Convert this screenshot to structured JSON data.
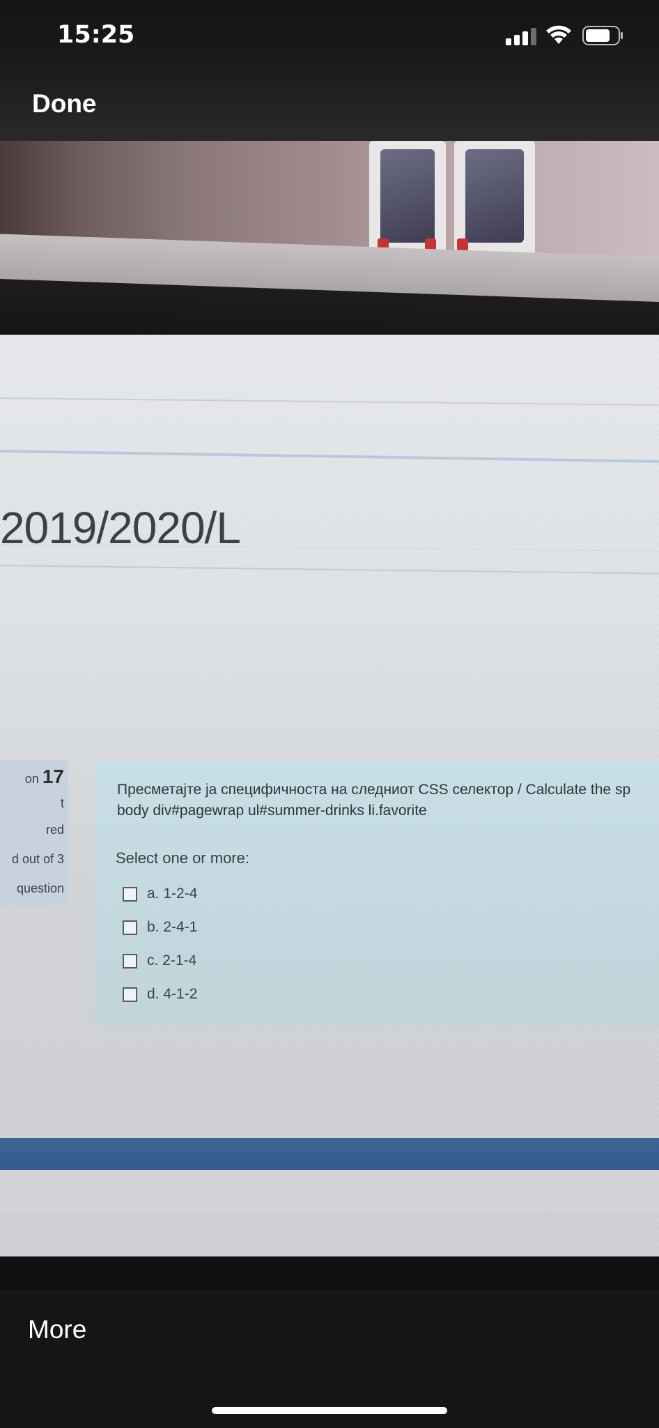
{
  "status_bar": {
    "time": "15:25"
  },
  "nav": {
    "done_label": "Done"
  },
  "photo": {
    "course_title": "2019/2020/L",
    "question_info": {
      "number_prefix": "on",
      "number": "17",
      "state": "t",
      "answered": "red",
      "marks": "d out of 3",
      "flag": "question"
    },
    "question_text_line1": "Пресметајте ја специфичноста на следниот CSS селектор / Calculate the sp",
    "question_text_line2": "body div#pagewrap ul#summer-drinks li.favorite",
    "prompt": "Select one or more:",
    "answers": [
      {
        "label": "a. 1-2-4"
      },
      {
        "label": "b. 2-4-1"
      },
      {
        "label": "c. 2-1-4"
      },
      {
        "label": "d. 4-1-2"
      }
    ]
  },
  "toolbar": {
    "more_label": "More"
  }
}
